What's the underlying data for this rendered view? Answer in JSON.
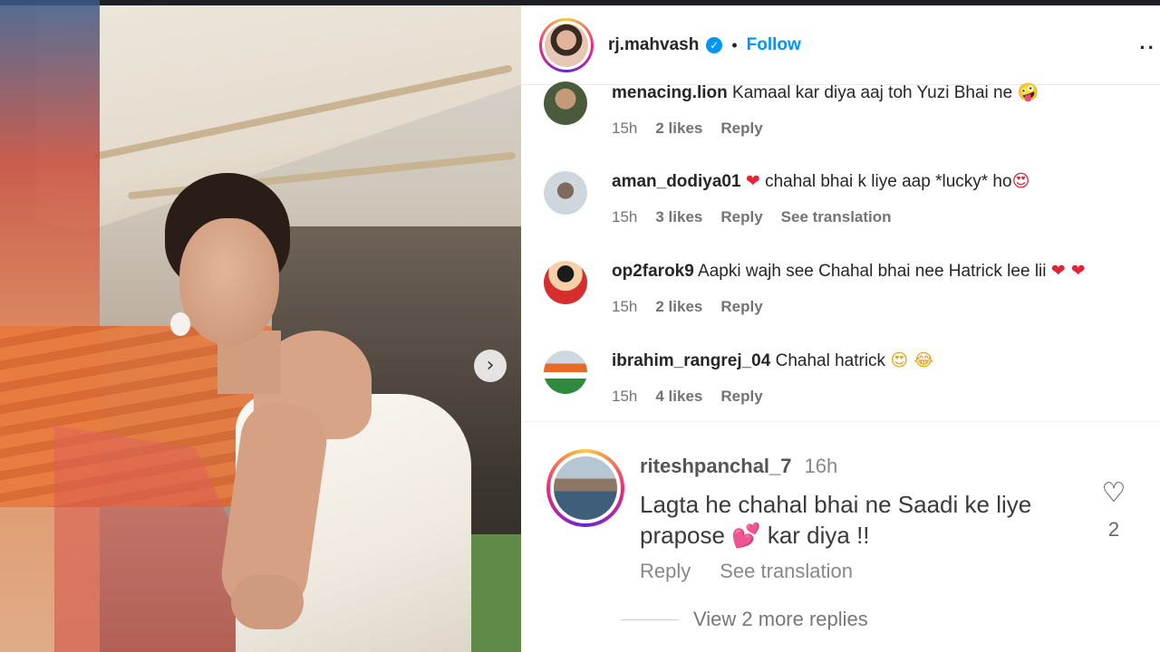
{
  "post": {
    "username": "rj.mahvash",
    "separator": "•",
    "follow_label": "Follow",
    "more_icon": "more-horizontal-icon",
    "verified_icon": "verified-badge-icon",
    "next_icon": "chevron-right-icon"
  },
  "comments": [
    {
      "username": "menacing.lion",
      "text": "Kamaal kar diya aaj toh Yuzi Bhai ne",
      "emoji": "🤪",
      "time": "15h",
      "likes": "2 likes",
      "reply": "Reply"
    },
    {
      "username": "aman_dodiya01",
      "pre_emoji": "❤",
      "text": "chahal bhai k liye aap *lucky* ho",
      "emoji": "😍",
      "time": "15h",
      "likes": "3 likes",
      "reply": "Reply",
      "see_translation": "See translation"
    },
    {
      "username": "op2farok9",
      "text": "Aapki wajh see Chahal bhai nee Hatrick lee lii",
      "emoji": "❤ ❤",
      "time": "15h",
      "likes": "2 likes",
      "reply": "Reply"
    },
    {
      "username": "ibrahim_rangrej_04",
      "text": "Chahal hatrick",
      "emoji": "😍 😂",
      "time": "15h",
      "likes": "4 likes",
      "reply": "Reply"
    }
  ],
  "highlight_comment": {
    "username": "riteshpanchal_7",
    "time": "16h",
    "text_line1": "Lagta he chahal bhai ne Saadi ke liye",
    "text_line2_pre": "prapose",
    "text_line2_emoji": "💕",
    "text_line2_post": "kar diya !!",
    "reply": "Reply",
    "see_translation": "See translation",
    "like_count": "2",
    "view_replies": "View 2 more replies"
  }
}
